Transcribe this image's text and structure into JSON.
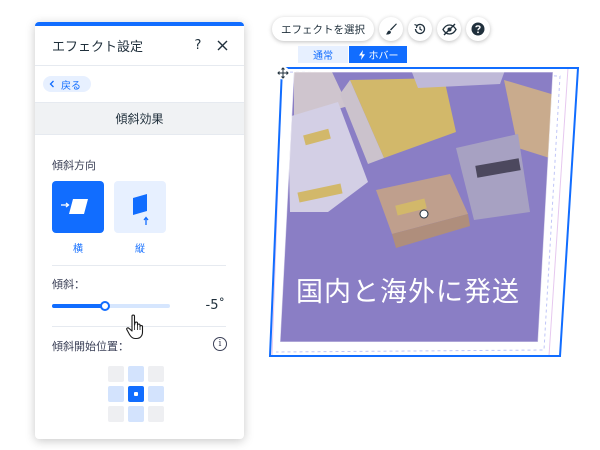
{
  "panel": {
    "title": "エフェクト設定",
    "help_label": "?",
    "back_label": "戻る",
    "section_title": "傾斜効果",
    "direction_label": "傾斜方向",
    "directions": [
      {
        "label": "横",
        "selected": true
      },
      {
        "label": "縦",
        "selected": false
      }
    ],
    "skew_label": "傾斜：",
    "skew_value": "-5˚",
    "skew_slider_fraction": 0.45,
    "origin_label": "傾斜開始位置：",
    "info_label": "i"
  },
  "toolbar": {
    "effect_select_label": "エフェクトを選択",
    "icons": [
      "brush-icon",
      "reset-history-icon",
      "hide-eye-icon",
      "help-icon"
    ]
  },
  "tabs": {
    "normal": "通常",
    "hover": "ホバー"
  },
  "canvas": {
    "overlay_text": "国内と海外に発送"
  },
  "colors": {
    "accent": "#116dff",
    "accent_light": "#e7f0ff",
    "image_bg": "#8f84c8",
    "box_yellow": "#f3d54a",
    "box_tan": "#d9b27a"
  }
}
